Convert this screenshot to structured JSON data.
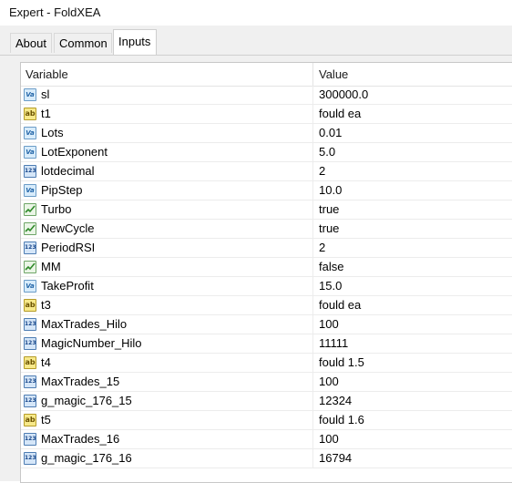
{
  "window": {
    "title": "Expert - FoldXEA"
  },
  "tabs": [
    {
      "label": "About",
      "active": false
    },
    {
      "label": "Common",
      "active": false
    },
    {
      "label": "Inputs",
      "active": true
    }
  ],
  "grid": {
    "columns": {
      "variable": "Variable",
      "value": "Value"
    },
    "rows": [
      {
        "type": "double",
        "icon_text": "Va",
        "name": "sl",
        "value": "300000.0"
      },
      {
        "type": "string",
        "icon_text": "ab",
        "name": "t1",
        "value": "fould ea"
      },
      {
        "type": "double",
        "icon_text": "Va",
        "name": "Lots",
        "value": "0.01"
      },
      {
        "type": "double",
        "icon_text": "Va",
        "name": "LotExponent",
        "value": "5.0"
      },
      {
        "type": "int",
        "icon_text": "123",
        "name": "lotdecimal",
        "value": "2"
      },
      {
        "type": "double",
        "icon_text": "Va",
        "name": "PipStep",
        "value": "10.0"
      },
      {
        "type": "bool",
        "icon_text": "",
        "name": "Turbo",
        "value": "true"
      },
      {
        "type": "bool",
        "icon_text": "",
        "name": "NewCycle",
        "value": "true"
      },
      {
        "type": "int",
        "icon_text": "123",
        "name": "PeriodRSI",
        "value": "2"
      },
      {
        "type": "bool",
        "icon_text": "",
        "name": "MM",
        "value": "false"
      },
      {
        "type": "double",
        "icon_text": "Va",
        "name": "TakeProfit",
        "value": "15.0"
      },
      {
        "type": "string",
        "icon_text": "ab",
        "name": "t3",
        "value": "fould ea"
      },
      {
        "type": "int",
        "icon_text": "123",
        "name": "MaxTrades_Hilo",
        "value": "100"
      },
      {
        "type": "int",
        "icon_text": "123",
        "name": "MagicNumber_Hilo",
        "value": "11111"
      },
      {
        "type": "string",
        "icon_text": "ab",
        "name": "t4",
        "value": "fould 1.5"
      },
      {
        "type": "int",
        "icon_text": "123",
        "name": "MaxTrades_15",
        "value": "100"
      },
      {
        "type": "int",
        "icon_text": "123",
        "name": "g_magic_176_15",
        "value": "12324"
      },
      {
        "type": "string",
        "icon_text": "ab",
        "name": "t5",
        "value": "fould 1.6"
      },
      {
        "type": "int",
        "icon_text": "123",
        "name": "MaxTrades_16",
        "value": "100"
      },
      {
        "type": "int",
        "icon_text": "123",
        "name": "g_magic_176_16",
        "value": "16794"
      }
    ]
  }
}
